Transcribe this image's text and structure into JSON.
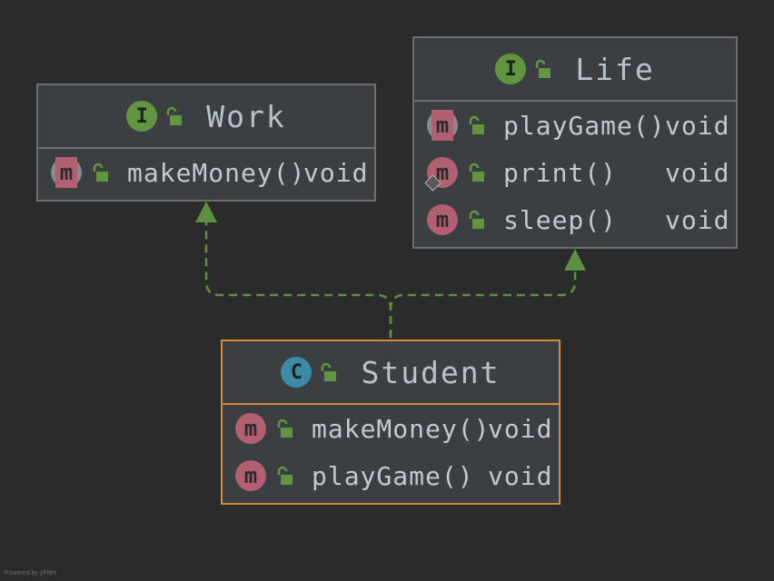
{
  "nodes": {
    "work": {
      "title": "Work",
      "kind_icon": "interface-icon",
      "kind_letter": "I",
      "methods": [
        {
          "name": "makeMoney()",
          "type": "void"
        }
      ]
    },
    "life": {
      "title": "Life",
      "kind_icon": "interface-icon",
      "kind_letter": "I",
      "methods": [
        {
          "name": "playGame()",
          "type": "void"
        },
        {
          "name": "print()",
          "type": "void"
        },
        {
          "name": "sleep()",
          "type": "void"
        }
      ]
    },
    "student": {
      "title": "Student",
      "kind_icon": "class-icon",
      "kind_letter": "C",
      "methods": [
        {
          "name": "makeMoney()",
          "type": "void"
        },
        {
          "name": "playGame()",
          "type": "void"
        }
      ]
    }
  },
  "method_icon_letter": "m",
  "edges": [
    {
      "from": "Student",
      "to": "Work",
      "kind": "implements"
    },
    {
      "from": "Student",
      "to": "Life",
      "kind": "implements"
    }
  ],
  "footer": "Powered by yFiles",
  "colors": {
    "background": "#2b2b2b",
    "node_fill": "#3c3f41",
    "node_border": "#6e6e6e",
    "selected_border": "#d18a3e",
    "interface_badge": "#62953f",
    "class_badge": "#3b8aa8",
    "method_badge": "#b25f72",
    "edge": "#5d9142"
  }
}
